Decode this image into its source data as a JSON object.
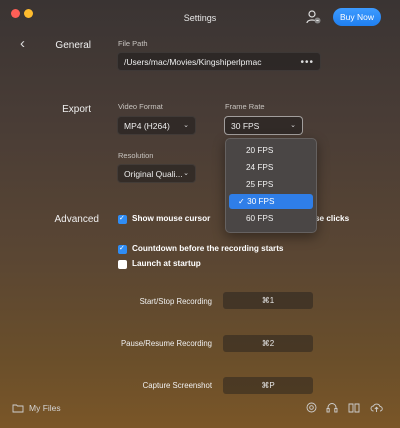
{
  "window": {
    "title": "Settings"
  },
  "header": {
    "buy_label": "Buy Now"
  },
  "sections": {
    "general": "General",
    "export": "Export",
    "advanced": "Advanced"
  },
  "general": {
    "file_path_label": "File Path",
    "file_path_value": "/Users/mac/Movies/Kingshiperlpmac",
    "more": "•••"
  },
  "export": {
    "video_format_label": "Video Format",
    "video_format_value": "MP4 (H264)",
    "frame_rate_label": "Frame Rate",
    "frame_rate_value": "30 FPS",
    "resolution_label": "Resolution",
    "resolution_value": "Original Quali..."
  },
  "frame_rate_options": [
    {
      "label": "20 FPS",
      "selected": false
    },
    {
      "label": "24 FPS",
      "selected": false
    },
    {
      "label": "25 FPS",
      "selected": false
    },
    {
      "label": "✓ 30 FPS",
      "selected": true
    },
    {
      "label": "60 FPS",
      "selected": false
    }
  ],
  "advanced": {
    "show_mouse_cursor": "Show mouse cursor",
    "show_mouse_cursor_checked": true,
    "clicks_partial": "se clicks",
    "countdown": "Countdown before the recording starts",
    "countdown_checked": true,
    "launch_startup": "Launch at startup",
    "launch_startup_checked": false
  },
  "shortcuts": [
    {
      "label": "Start/Stop Recording",
      "key": "⌘1"
    },
    {
      "label": "Pause/Resume Recording",
      "key": "⌘2"
    },
    {
      "label": "Capture Screenshot",
      "key": "⌘P"
    }
  ],
  "footer": {
    "my_files": "My Files"
  },
  "icons": [
    "back-chevron-icon",
    "user-icon",
    "folder-icon",
    "target-icon",
    "headset-icon",
    "book-icon",
    "cloud-upload-icon"
  ]
}
